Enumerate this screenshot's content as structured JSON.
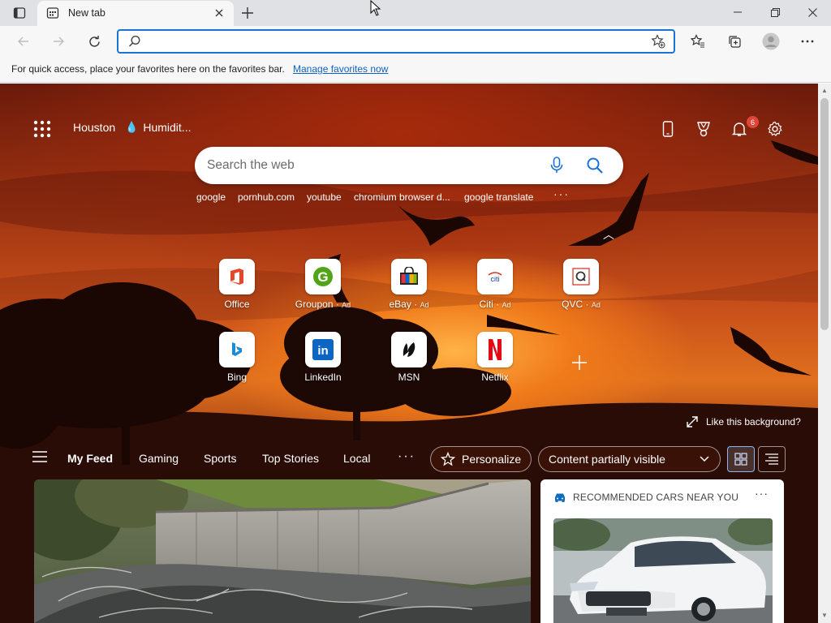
{
  "browser": {
    "tab": {
      "title": "New tab"
    },
    "address_bar": {
      "value": "",
      "placeholder": ""
    },
    "favorites_bar": {
      "message": "For quick access, place your favorites here on the favorites bar.",
      "link": "Manage favorites now"
    }
  },
  "newtab": {
    "weather": {
      "city": "Houston",
      "condition": "Humidit..."
    },
    "notifications_count": "6",
    "search": {
      "placeholder": "Search the web"
    },
    "trending": [
      "google",
      "pornhub.com",
      "youtube",
      "chromium browser d...",
      "google translate"
    ],
    "trending_more": "···",
    "quick_links": [
      {
        "name": "Office",
        "ad": ""
      },
      {
        "name": "Groupon",
        "ad": "Ad"
      },
      {
        "name": "eBay",
        "ad": "Ad"
      },
      {
        "name": "Citi",
        "ad": "Ad"
      },
      {
        "name": "QVC",
        "ad": "Ad"
      },
      {
        "name": "Bing",
        "ad": ""
      },
      {
        "name": "LinkedIn",
        "ad": ""
      },
      {
        "name": "MSN",
        "ad": ""
      },
      {
        "name": "Netflix",
        "ad": ""
      }
    ],
    "like_background": "Like this background?",
    "feed_tabs": [
      "My Feed",
      "Gaming",
      "Sports",
      "Top Stories",
      "Local"
    ],
    "feed_more": "···",
    "personalize": "Personalize",
    "content_visibility": "Content partially visible",
    "side_card": {
      "title": "RECOMMENDED CARS NEAR YOU",
      "more": "···"
    }
  },
  "colors": {
    "accent": "#1a73d9",
    "link": "#0b62c4",
    "badge": "#e0453a"
  }
}
